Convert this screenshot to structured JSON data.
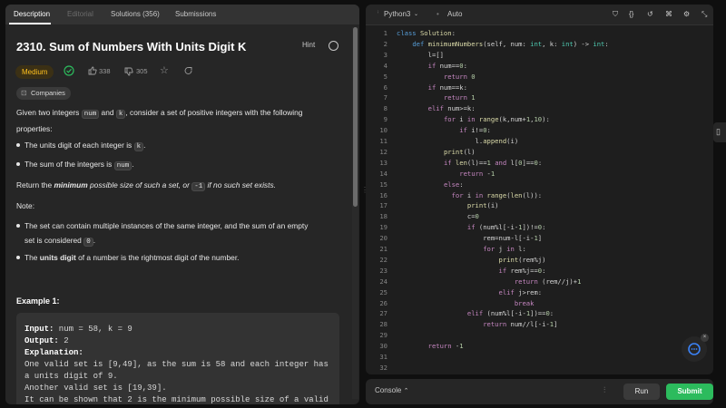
{
  "tabs": [
    "Description",
    "Editorial",
    "Solutions (356)",
    "Submissions"
  ],
  "problem": {
    "title": "2310. Sum of Numbers With Units Digit K",
    "hint": "Hint",
    "difficulty": "Medium",
    "likes": "338",
    "dislikes": "305",
    "companies": "Companies",
    "intro_a": "Given two integers",
    "intro_code1": "num",
    "intro_b": "and",
    "intro_code2": "k",
    "intro_c": ", consider a set of positive integers with the following",
    "intro_d": "properties:",
    "bullet1_text": "The units digit of each integer is",
    "bullet1_code": "k",
    "bullet2_text": "The sum of the integers is",
    "bullet2_code": "num",
    "return_a": "Return the",
    "return_b": "minimum",
    "return_c": "possible size of such a set, or",
    "return_code": "-1",
    "return_d": "if no such set exists.",
    "note": "Note:",
    "note1a": "The set can contain multiple instances of the same integer, and the sum of an empty",
    "note1b": "set is considered",
    "note1_code": "0",
    "note2a": "The",
    "note2b": "units digit",
    "note2c": "of a number is the rightmost digit of the number."
  },
  "example": {
    "title": "Example 1:",
    "input_label": "Input:",
    "input_value": " num = 58, k = 9",
    "output_label": "Output:",
    "output_value": " 2",
    "explanation_label": "Explanation:",
    "line1": "One valid set is [9,49], as the sum is 58 and each integer has",
    "line2": "a units digit of 9.",
    "line3": "Another valid set is [19,39].",
    "line4": "It can be shown that 2 is the minimum possible size of a valid"
  },
  "editor": {
    "language": "Python3",
    "mode": "Auto",
    "code_lines": [
      "class Solution:",
      "    def minimumNumbers(self, num: int, k: int) -> int:",
      "        l=[]",
      "        if num==0:",
      "            return 0",
      "        if num==k:",
      "            return 1",
      "        elif num>=k:",
      "            for i in range(k,num+1,10):",
      "                if i!=0:",
      "                    l.append(i)",
      "            print(l)",
      "            if len(l)==1 and l[0]==0:",
      "                return -1",
      "            else:",
      "              for i in range(len(l)):",
      "                  print(i)",
      "                  c=0",
      "                  if (num%l[-i-1])!=0:",
      "                      rem=num-l[-i-1]",
      "                      for j in l:",
      "                          print(rem%j)",
      "                          if rem%j==0:",
      "                              return (rem//j)+1",
      "                          elif j>rem:",
      "                              break",
      "                  elif (num%l[-i-1])==0:",
      "                      return num//l[-i-1]",
      "",
      "        return -1",
      "",
      "",
      "",
      ""
    ],
    "line_numbers": [
      "1",
      "2",
      "3",
      "4",
      "5",
      "6",
      "7",
      "8",
      "9",
      "10",
      "11",
      "12",
      "13",
      "14",
      "15",
      "16",
      "17",
      "18",
      "19",
      "20",
      "21",
      "22",
      "23",
      "24",
      "25",
      "26",
      "27",
      "28",
      "29",
      "30",
      "31",
      "32",
      "33",
      "34"
    ]
  },
  "console": {
    "label": "Console",
    "run": "Run",
    "submit": "Submit"
  },
  "colors": {
    "accent_green": "#2cbb5d",
    "medium": "#ffc01e",
    "keyword": "#569cd6"
  }
}
